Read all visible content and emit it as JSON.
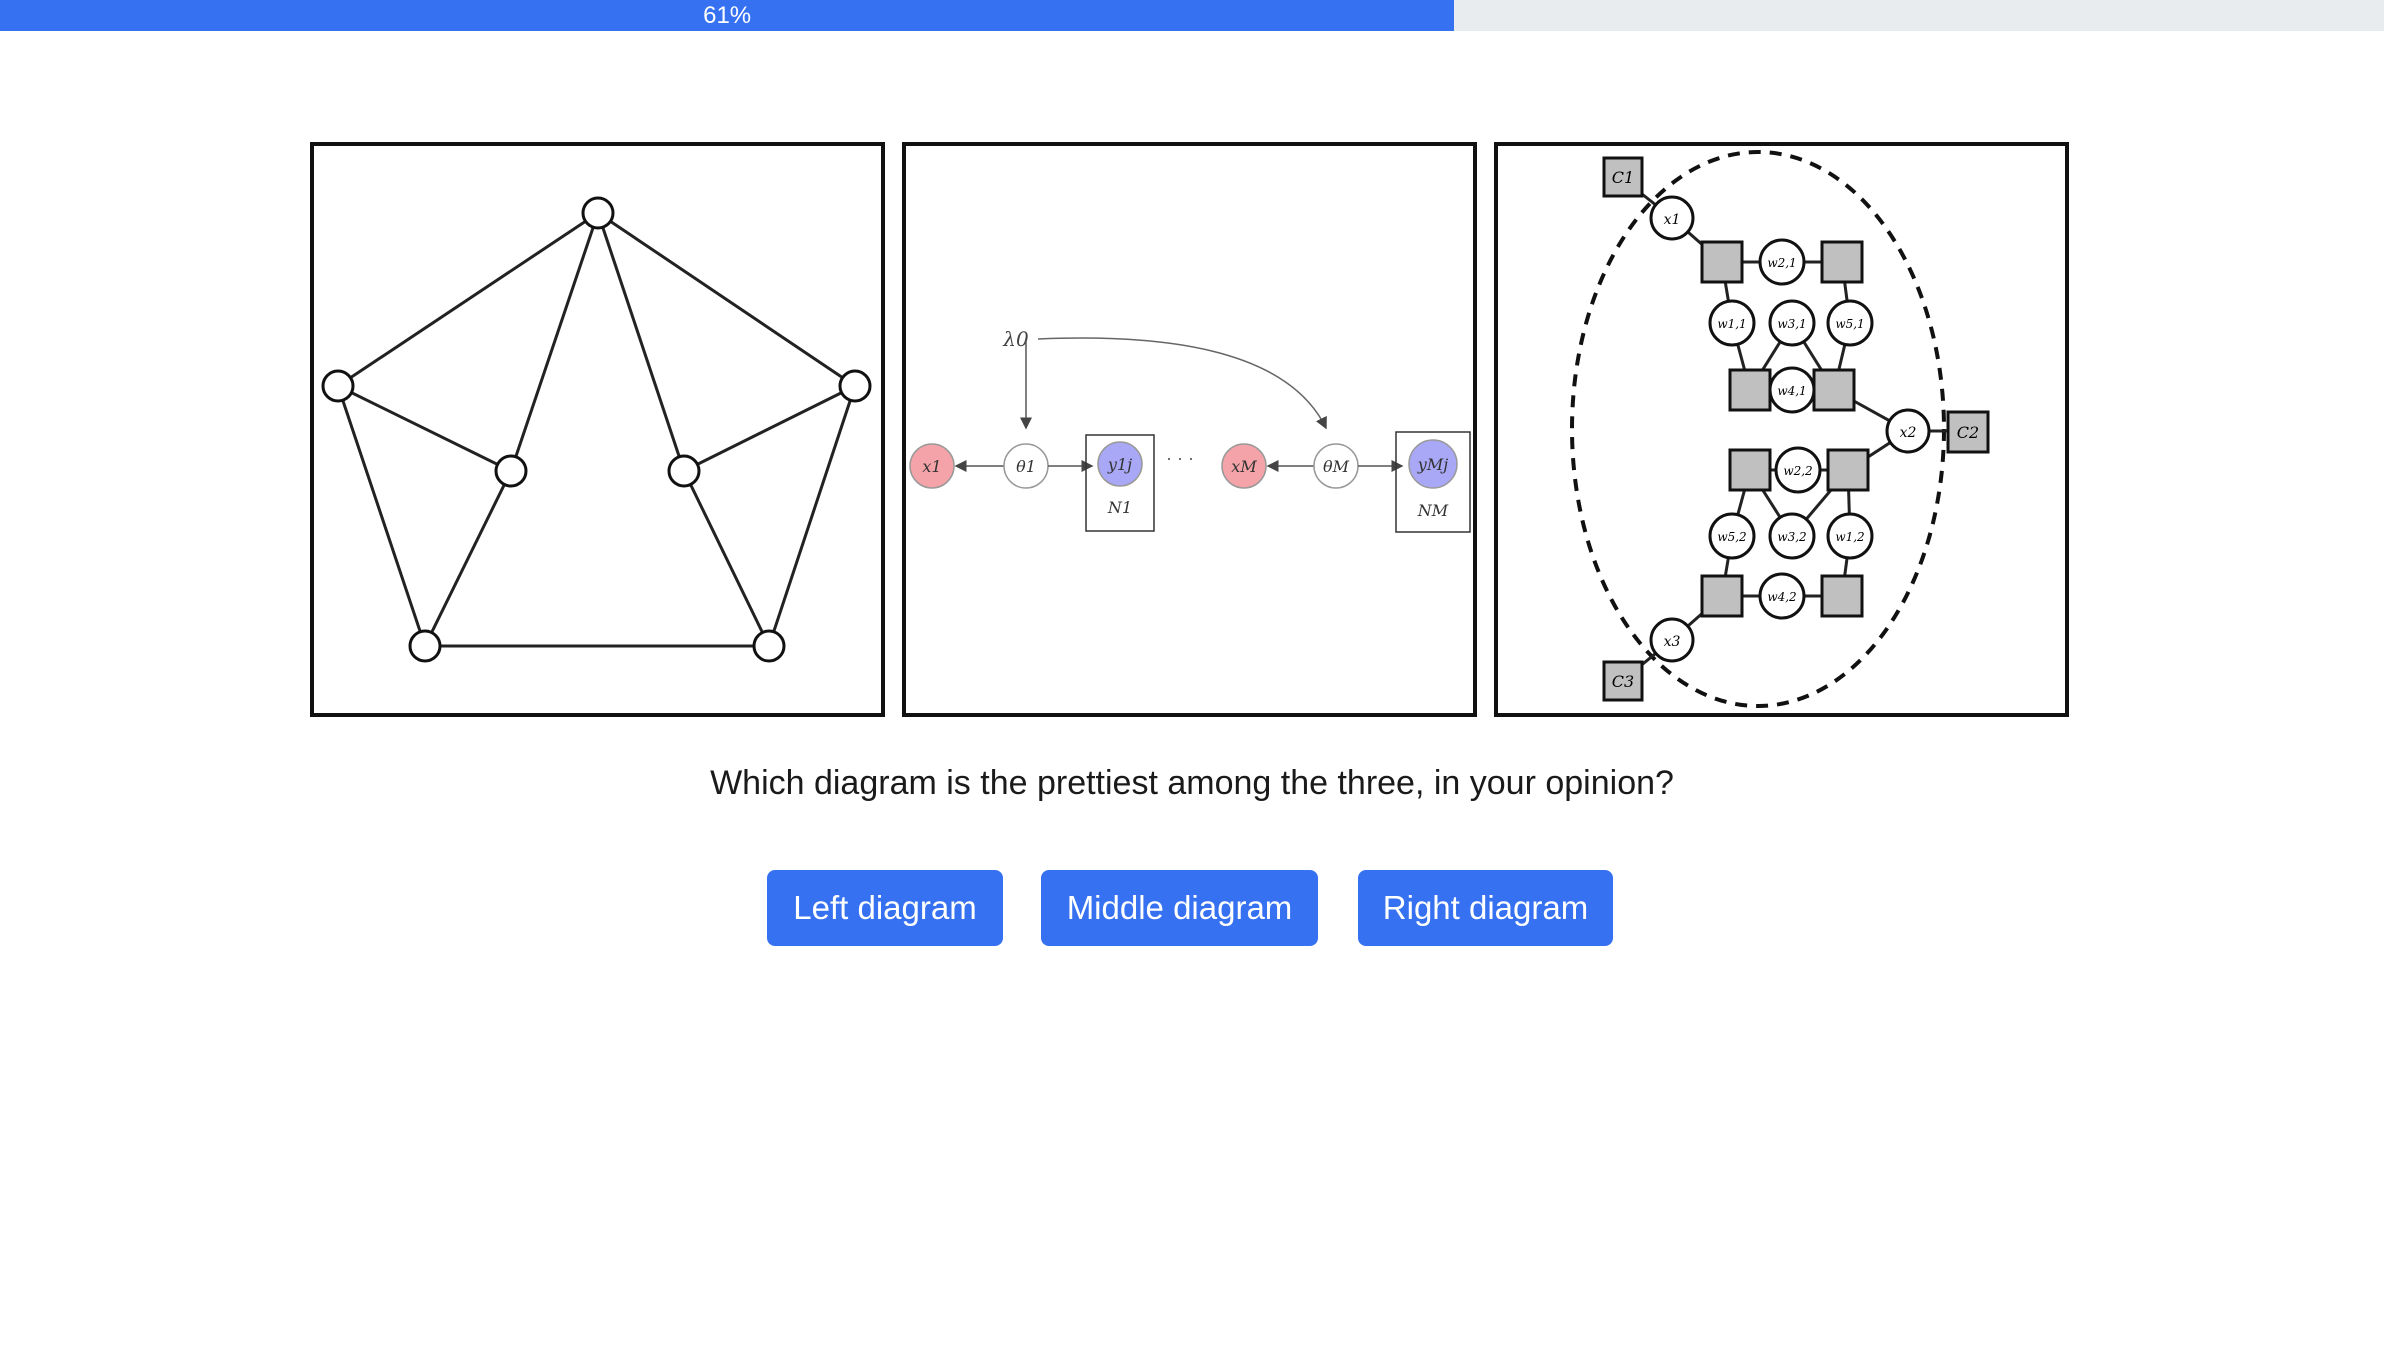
{
  "progress": {
    "value": 0.61,
    "label": "61%"
  },
  "question": "Which diagram is the prettiest among the three, in your opinion?",
  "buttons": {
    "left": "Left diagram",
    "middle": "Middle diagram",
    "right": "Right diagram"
  },
  "diagrams": {
    "middle": {
      "lambda": "λ0",
      "x1": "x1",
      "theta1": "θ1",
      "y1j": "y1j",
      "N1": "N1",
      "dots": "· · ·",
      "xM": "xM",
      "thetaM": "θM",
      "yMj": "yMj",
      "NM": "NM"
    },
    "right": {
      "C1": "C1",
      "C2": "C2",
      "C3": "C3",
      "x1": "x1",
      "x2": "x2",
      "x3": "x3",
      "w11": "w1,1",
      "w21": "w2,1",
      "w31": "w3,1",
      "w41": "w4,1",
      "w51": "w5,1",
      "w12": "w1,2",
      "w22": "w2,2",
      "w32": "w3,2",
      "w42": "w4,2",
      "w52": "w5,2"
    }
  },
  "colors": {
    "accent": "#3571f1",
    "track": "#e9ecef",
    "red_node": "#f4a3a8",
    "blue_node": "#a9a8f6",
    "factor": "#c0c0c0"
  }
}
